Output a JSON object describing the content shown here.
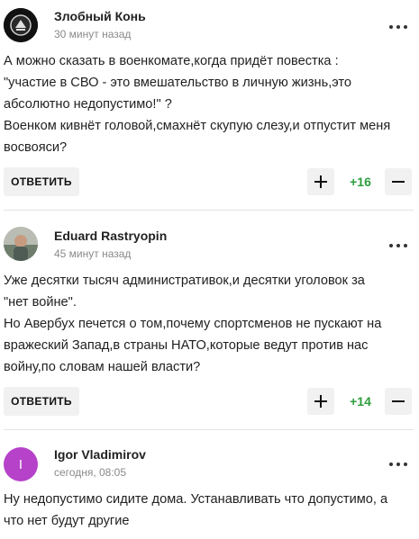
{
  "comments": [
    {
      "author": "Злобный Конь",
      "time": "30 минут назад",
      "avatar_icon": "dark-badge-avatar",
      "avatar_color": "#111111",
      "text_lines": [
        "А можно сказать в военкомате,когда придёт повестка :",
        "\"участие в СВО - это вмешательство в личную жизнь,это",
        "абсолютно недопустимо!\" ?",
        "Военком кивнёт головой,смахнёт скупую слезу,и отпустит меня",
        "восвояси?"
      ],
      "reply_label": "ОТВЕТИТЬ",
      "score": "+16"
    },
    {
      "author": "Eduard Rastryopin",
      "time": "45 минут назад",
      "avatar_icon": "photo-avatar",
      "avatar_color": "#9aa39a",
      "text_lines": [
        "Уже десятки тысяч административок,и десятки уголовок за",
        "\"нет войне\".",
        "Но Авербух печется о том,почему спортсменов не пускают на",
        "вражеский Запад,в страны НАТО,которые ведут против нас",
        "войну,по словам нашей власти?"
      ],
      "reply_label": "ОТВЕТИТЬ",
      "score": "+14"
    },
    {
      "author": "Igor Vladimirov",
      "time": "сегодня, 08:05",
      "avatar_letter": "I",
      "avatar_color": "#b542c9",
      "text_lines": [
        "Ну недопустимо сидите дома. Устанавливать что допустимо, а",
        "что нет будут другие"
      ]
    }
  ],
  "score_color": "#2e9e3e"
}
